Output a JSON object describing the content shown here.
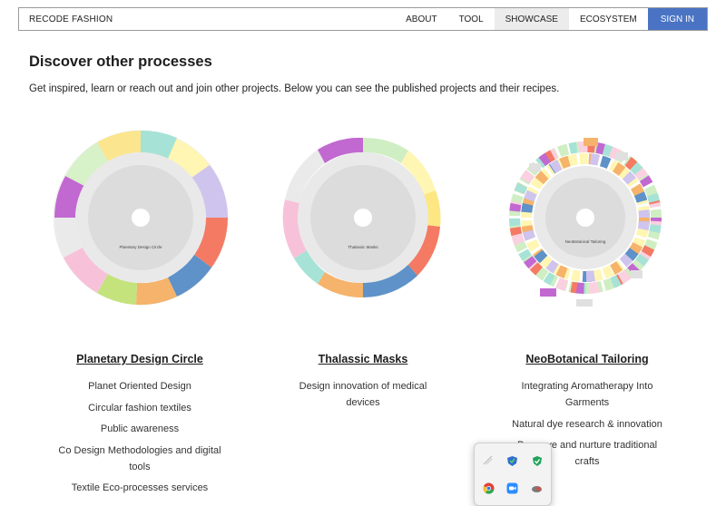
{
  "nav": {
    "brand": "RECODE FASHION",
    "links": [
      "ABOUT",
      "TOOL",
      "SHOWCASE",
      "ECOSYSTEM"
    ],
    "active": "SHOWCASE",
    "signin": "SIGN IN",
    "signin_color": "#4a73c4"
  },
  "page": {
    "title": "Discover other processes",
    "intro": "Get inspired, learn or reach out and join other projects. Below you can see the published projects and their recipes."
  },
  "projects": [
    {
      "title": "Planetary Design Circle",
      "center_label": "Planetary Design Circle",
      "recipes": [
        "Planet Oriented Design",
        "Circular fashion textiles",
        "Public awareness",
        "Co Design Methodologies and digital tools",
        "Textile Eco-processes services"
      ]
    },
    {
      "title": "Thalassic Masks",
      "center_label": "Thalassic Masks",
      "recipes": [
        "Design innovation of medical devices"
      ]
    },
    {
      "title": "NeoBotanical Tailoring",
      "center_label": "NeoBotanical Tailoring",
      "recipes": [
        "Integrating Aromatherapy Into Garments",
        "Natural dye research & innovation",
        "Preserve and nurture traditional crafts"
      ]
    }
  ],
  "tray": {
    "icons": [
      "network-icon",
      "vpn-shield-icon",
      "security-shield-icon",
      "chrome-icon",
      "zoom-icon",
      "cloud-icon"
    ]
  }
}
